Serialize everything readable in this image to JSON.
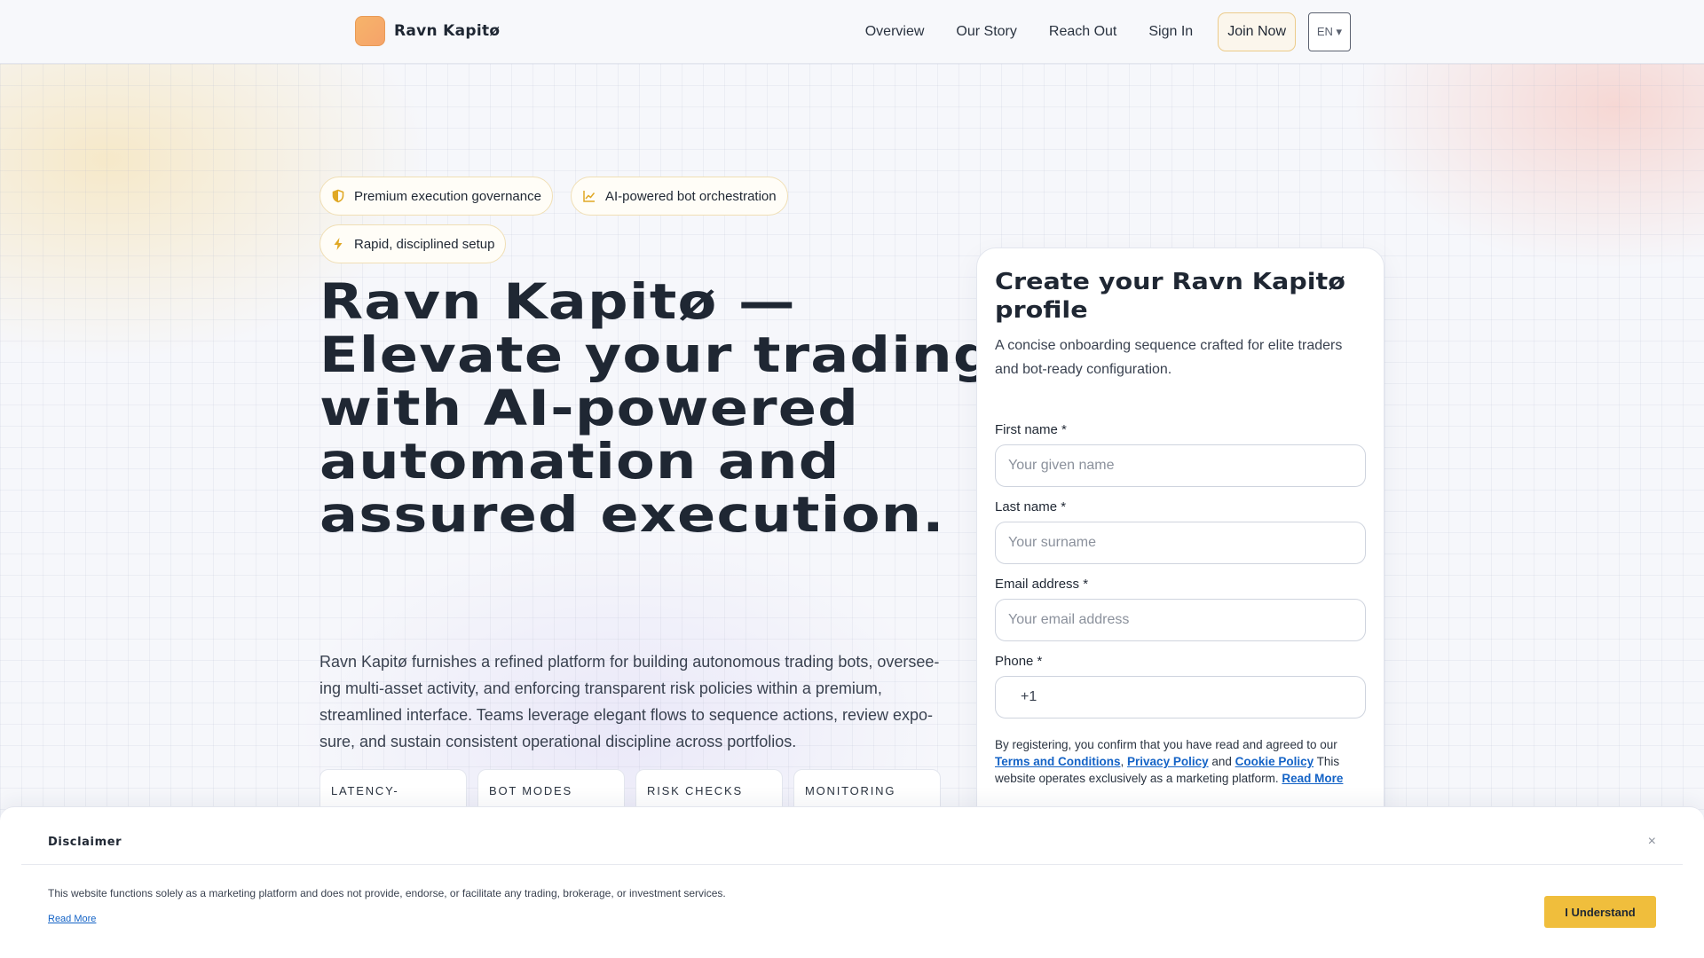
{
  "brand": {
    "name": "Ravn Kapitø"
  },
  "nav": {
    "items": [
      "Overview",
      "Our Story",
      "Reach Out",
      "Sign In"
    ],
    "join_label": "Join Now",
    "lang_label": "EN ▾"
  },
  "hero": {
    "chips": [
      {
        "label": "Premium execution governance",
        "icon": "shield-icon"
      },
      {
        "label": "AI-powered bot orchestration",
        "icon": "chart-line-icon"
      },
      {
        "label": "Rapid, disciplined setup",
        "icon": "bolt-icon"
      }
    ],
    "title": "Ravn Kapitø — Elevate your trading with AI-powered automation and assured execution.",
    "description": "Ravn Kapitø furnishes a refined platform for building autonomous trading bots, oversee-ing multi-asset activity, and enforcing transparent risk policies within a premium, streamlined interface. Teams leverage elegant flows to sequence actions, review expo-sure, and sustain consistent operational discipline across portfolios.",
    "stats": [
      "LATENCY-",
      "BOT MODES",
      "RISK CHECKS",
      "MONITORING"
    ]
  },
  "form": {
    "title": "Create your Ravn Kapitø profile",
    "subtitle": "A concise onboarding sequence crafted for elite traders and bot-ready configuration.",
    "first_name_label": "First name *",
    "first_name_placeholder": "Your given name",
    "last_name_label": "Last name *",
    "last_name_placeholder": "Your surname",
    "email_label": "Email address *",
    "email_placeholder": "Your email address",
    "phone_label": "Phone *",
    "phone_prefix": "+1",
    "terms_prefix": "By registering, you confirm that you have read and agreed to our ",
    "terms_link": "Terms and Conditions",
    "sep1": ", ",
    "privacy_link": "Privacy Policy",
    "and": " and ",
    "cookie_link": "Cookie Policy",
    "terms_suffix": " This website operates exclusively as a marketing platform. ",
    "read_more": "Read More"
  },
  "disclaimer": {
    "title": "Disclaimer",
    "close": "×",
    "text": "This website functions solely as a marketing platform and does not provide, endorse, or facilitate any trading, brokerage, or investment services.",
    "read_more": "Read More",
    "button": "I Understand"
  },
  "colors": {
    "accent": "#f0be3c",
    "link": "#1463c6",
    "logo": "#f5a36a"
  }
}
